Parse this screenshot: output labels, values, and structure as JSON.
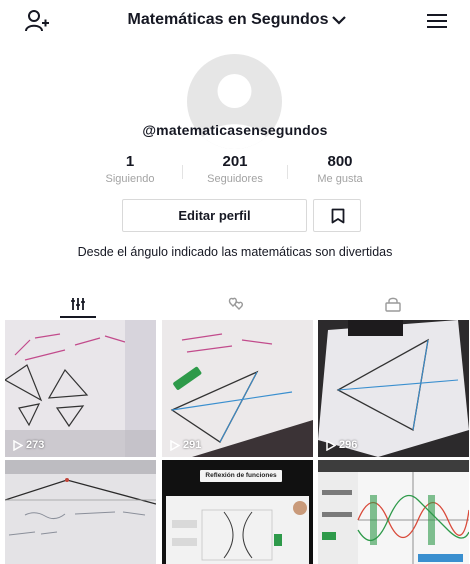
{
  "header": {
    "title": "Matemáticas en Segundos",
    "icons": {
      "left": "add-user-icon",
      "title_suffix": "chevron-down-icon",
      "right": "menu-icon"
    }
  },
  "profile": {
    "username": "@matematicasensegundos",
    "stats": [
      {
        "value": "1",
        "label": "Siguiendo"
      },
      {
        "value": "201",
        "label": "Seguidores"
      },
      {
        "value": "800",
        "label": "Me gusta"
      }
    ],
    "edit_button_label": "Editar perfil",
    "bio": "Desde el ángulo indicado las matemáticas son divertidas"
  },
  "tabs": [
    {
      "icon": "videos-grid-icon",
      "active": true
    },
    {
      "icon": "liked-hearts-icon",
      "active": false
    },
    {
      "icon": "private-lock-icon",
      "active": false
    }
  ],
  "videos": [
    {
      "views": "273",
      "kind": "triangles-paper"
    },
    {
      "views": "291",
      "kind": "triangle-lines-paper"
    },
    {
      "views": "296",
      "kind": "triangle-paper-desk"
    },
    {
      "views": "",
      "kind": "whiteboard-triangle"
    },
    {
      "views": "",
      "kind": "slides",
      "title": "Reflexión de funciones"
    },
    {
      "views": "",
      "kind": "graph-software"
    }
  ],
  "colors": {
    "text": "#161823",
    "muted": "#a3a3a3",
    "border": "#d9d9d9",
    "accent_green": "#2e9a4a",
    "graph_red": "#d94a3a"
  }
}
